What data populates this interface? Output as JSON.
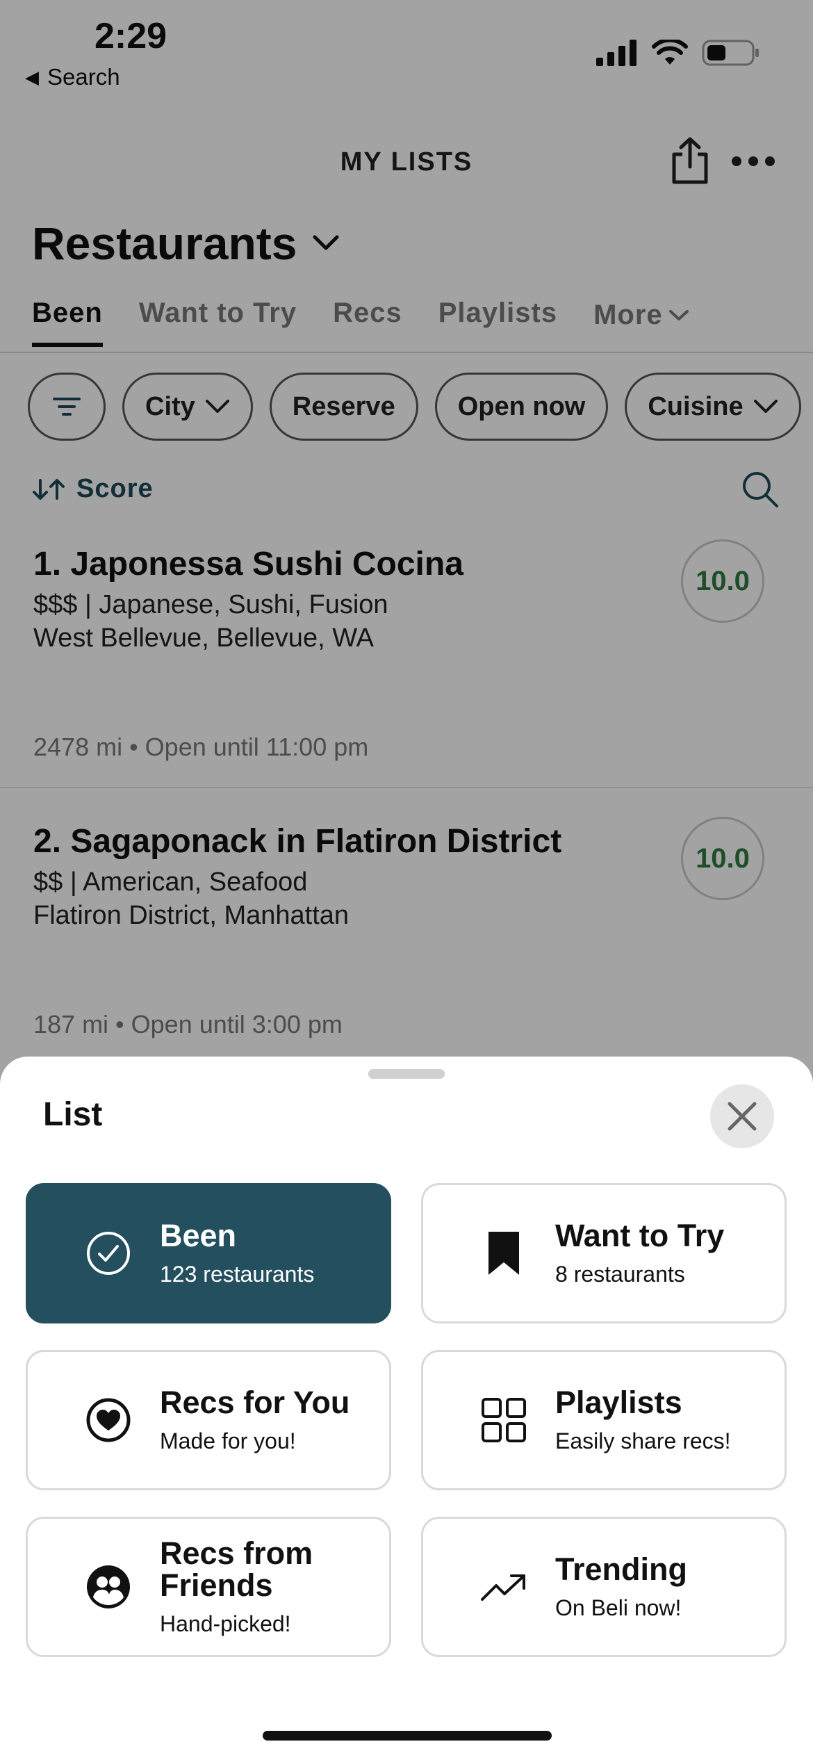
{
  "status_bar": {
    "time": "2:29",
    "back_label": "Search"
  },
  "header": {
    "title": "MY LISTS"
  },
  "list": {
    "title": "Restaurants"
  },
  "tabs": [
    {
      "label": "Been"
    },
    {
      "label": "Want to Try"
    },
    {
      "label": "Recs"
    },
    {
      "label": "Playlists"
    },
    {
      "label": "More"
    }
  ],
  "filters": [
    {
      "label": "City"
    },
    {
      "label": "Reserve"
    },
    {
      "label": "Open now"
    },
    {
      "label": "Cuisine"
    }
  ],
  "sort": {
    "label": "Score"
  },
  "restaurants": [
    {
      "name": "1. Japonessa Sushi Cocina",
      "price_cuisine": "$$$ | Japanese, Sushi, Fusion",
      "location": "West Bellevue, Bellevue, WA",
      "footer": "2478 mi • Open until 11:00 pm",
      "score": "10.0"
    },
    {
      "name": "2. Sagaponack in Flatiron District",
      "price_cuisine": "$$ | American, Seafood",
      "location": "Flatiron District, Manhattan",
      "footer": "187 mi • Open until 3:00 pm",
      "score": "10.0"
    }
  ],
  "sheet": {
    "title": "List",
    "options": [
      {
        "label": "Been",
        "subtitle": "123 restaurants",
        "icon": "check-circle-icon",
        "selected": true
      },
      {
        "label": "Want to Try",
        "subtitle": "8 restaurants",
        "icon": "bookmark-icon",
        "selected": false
      },
      {
        "label": "Recs for You",
        "subtitle": "Made for you!",
        "icon": "heart-circle-icon",
        "selected": false
      },
      {
        "label": "Playlists",
        "subtitle": "Easily share recs!",
        "icon": "grid-icon",
        "selected": false
      },
      {
        "label": "Recs from Friends",
        "subtitle": "Hand-picked!",
        "icon": "friends-icon",
        "selected": false
      },
      {
        "label": "Trending",
        "subtitle": "On Beli now!",
        "icon": "trending-icon",
        "selected": false
      }
    ]
  },
  "colors": {
    "accent": "#244f5e",
    "score_green": "#2f7a3d",
    "sort_teal": "#1d4a5a"
  }
}
